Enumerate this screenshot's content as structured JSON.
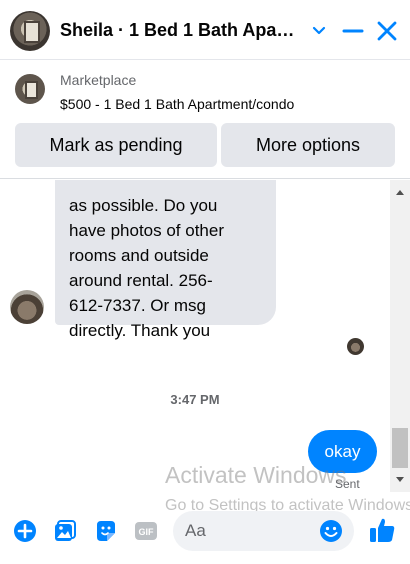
{
  "header": {
    "title": "Sheila · 1 Bed 1 Bath Apartment/condo",
    "icons": [
      "chevron-down-icon",
      "minimize-icon",
      "close-icon"
    ]
  },
  "marketplace": {
    "label": "Marketplace",
    "listing": "$500 - 1 Bed 1 Bath Apartment/condo",
    "pending_button": "Mark as pending",
    "more_button": "More options"
  },
  "conversation": {
    "incoming_message": "as possible. Do you\nhave photos of other\nrooms and outside\naround rental. 256-\n612-7337. Or msg\ndirectly.  Thank you",
    "timestamp": "3:47 PM",
    "outgoing_message": "okay",
    "sent_status": "Sent"
  },
  "composer": {
    "placeholder": "Aa",
    "icons": [
      "plus-icon",
      "image-icon",
      "sticker-icon",
      "gif-icon",
      "emoji-icon",
      "thumbs-up-icon"
    ]
  },
  "watermark": {
    "line1": "Activate Windows",
    "line2": "Go to Settings to activate Windows."
  },
  "colors": {
    "accent": "#0084ff",
    "bubble_in": "#e4e6eb",
    "muted_text": "#65676b"
  }
}
